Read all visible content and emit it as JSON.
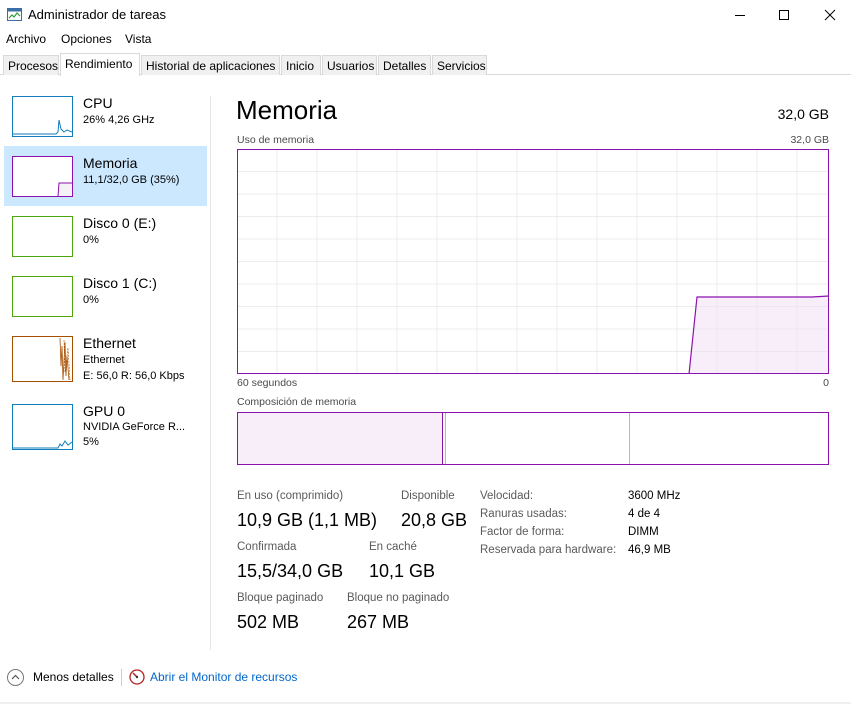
{
  "window": {
    "title": "Administrador de tareas"
  },
  "menu": [
    "Archivo",
    "Opciones",
    "Vista"
  ],
  "tabs": [
    "Procesos",
    "Rendimiento",
    "Historial de aplicaciones",
    "Inicio",
    "Usuarios",
    "Detalles",
    "Servicios"
  ],
  "sidebar": [
    {
      "title": "CPU",
      "line1": "26%  4,26 GHz",
      "line2": "",
      "line3": ""
    },
    {
      "title": "Memoria",
      "line1": "11,1/32,0 GB (35%)",
      "line2": "",
      "line3": ""
    },
    {
      "title": "Disco 0 (E:)",
      "line1": "0%",
      "line2": "",
      "line3": ""
    },
    {
      "title": "Disco 1 (C:)",
      "line1": "0%",
      "line2": "",
      "line3": ""
    },
    {
      "title": "Ethernet",
      "line1": "Ethernet",
      "line2": "E: 56,0  R: 56,0 Kbps",
      "line3": ""
    },
    {
      "title": "GPU 0",
      "line1": "NVIDIA GeForce R...",
      "line2": "5%",
      "line3": ""
    }
  ],
  "main": {
    "title": "Memoria",
    "total": "32,0 GB",
    "usage_label": "Uso de memoria",
    "usage_max": "32,0 GB",
    "time_left": "60 segundos",
    "time_right": "0",
    "composition_label": "Composición de memoria"
  },
  "stats": {
    "in_use_label": "En uso (comprimido)",
    "in_use_value": "10,9 GB (1,1 MB)",
    "available_label": "Disponible",
    "available_value": "20,8 GB",
    "committed_label": "Confirmada",
    "committed_value": "15,5/34,0 GB",
    "cached_label": "En caché",
    "cached_value": "10,1 GB",
    "paged_label": "Bloque paginado",
    "paged_value": "502 MB",
    "nonpaged_label": "Bloque no paginado",
    "nonpaged_value": "267 MB"
  },
  "properties": [
    {
      "label": "Velocidad:",
      "value": "3600 MHz"
    },
    {
      "label": "Ranuras usadas:",
      "value": "4 de 4"
    },
    {
      "label": "Factor de forma:",
      "value": "DIMM"
    },
    {
      "label": "Reservada para hardware:",
      "value": "46,9 MB"
    }
  ],
  "footer": {
    "less_details": "Menos detalles",
    "resource_monitor": "Abrir el Monitor de recursos"
  },
  "colors": {
    "memory": "#8b12ae",
    "cpu": "#117dbb",
    "disk": "#4da60c",
    "ethernet": "#a74f01",
    "selected": "#cce8ff"
  }
}
